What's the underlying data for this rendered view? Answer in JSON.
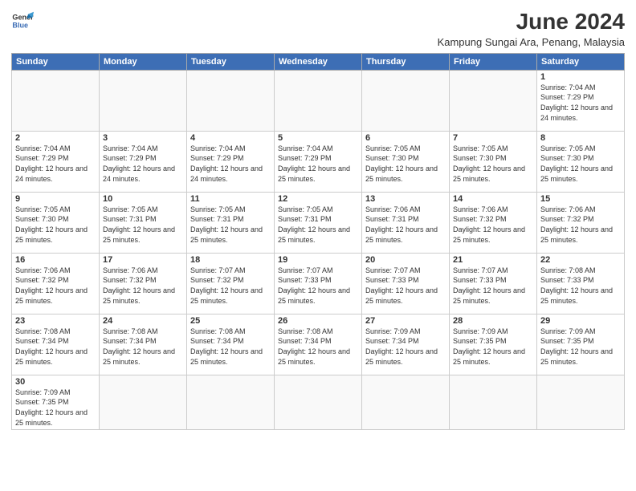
{
  "logo": {
    "line1": "General",
    "line2": "Blue"
  },
  "title": "June 2024",
  "location": "Kampung Sungai Ara, Penang, Malaysia",
  "days_of_week": [
    "Sunday",
    "Monday",
    "Tuesday",
    "Wednesday",
    "Thursday",
    "Friday",
    "Saturday"
  ],
  "weeks": [
    [
      {
        "day": "",
        "info": ""
      },
      {
        "day": "",
        "info": ""
      },
      {
        "day": "",
        "info": ""
      },
      {
        "day": "",
        "info": ""
      },
      {
        "day": "",
        "info": ""
      },
      {
        "day": "",
        "info": ""
      },
      {
        "day": "1",
        "info": "Sunrise: 7:04 AM\nSunset: 7:29 PM\nDaylight: 12 hours\nand 24 minutes."
      }
    ],
    [
      {
        "day": "2",
        "info": "Sunrise: 7:04 AM\nSunset: 7:29 PM\nDaylight: 12 hours\nand 24 minutes."
      },
      {
        "day": "3",
        "info": "Sunrise: 7:04 AM\nSunset: 7:29 PM\nDaylight: 12 hours\nand 24 minutes."
      },
      {
        "day": "4",
        "info": "Sunrise: 7:04 AM\nSunset: 7:29 PM\nDaylight: 12 hours\nand 24 minutes."
      },
      {
        "day": "5",
        "info": "Sunrise: 7:04 AM\nSunset: 7:29 PM\nDaylight: 12 hours\nand 25 minutes."
      },
      {
        "day": "6",
        "info": "Sunrise: 7:05 AM\nSunset: 7:30 PM\nDaylight: 12 hours\nand 25 minutes."
      },
      {
        "day": "7",
        "info": "Sunrise: 7:05 AM\nSunset: 7:30 PM\nDaylight: 12 hours\nand 25 minutes."
      },
      {
        "day": "8",
        "info": "Sunrise: 7:05 AM\nSunset: 7:30 PM\nDaylight: 12 hours\nand 25 minutes."
      }
    ],
    [
      {
        "day": "9",
        "info": "Sunrise: 7:05 AM\nSunset: 7:30 PM\nDaylight: 12 hours\nand 25 minutes."
      },
      {
        "day": "10",
        "info": "Sunrise: 7:05 AM\nSunset: 7:31 PM\nDaylight: 12 hours\nand 25 minutes."
      },
      {
        "day": "11",
        "info": "Sunrise: 7:05 AM\nSunset: 7:31 PM\nDaylight: 12 hours\nand 25 minutes."
      },
      {
        "day": "12",
        "info": "Sunrise: 7:05 AM\nSunset: 7:31 PM\nDaylight: 12 hours\nand 25 minutes."
      },
      {
        "day": "13",
        "info": "Sunrise: 7:06 AM\nSunset: 7:31 PM\nDaylight: 12 hours\nand 25 minutes."
      },
      {
        "day": "14",
        "info": "Sunrise: 7:06 AM\nSunset: 7:32 PM\nDaylight: 12 hours\nand 25 minutes."
      },
      {
        "day": "15",
        "info": "Sunrise: 7:06 AM\nSunset: 7:32 PM\nDaylight: 12 hours\nand 25 minutes."
      }
    ],
    [
      {
        "day": "16",
        "info": "Sunrise: 7:06 AM\nSunset: 7:32 PM\nDaylight: 12 hours\nand 25 minutes."
      },
      {
        "day": "17",
        "info": "Sunrise: 7:06 AM\nSunset: 7:32 PM\nDaylight: 12 hours\nand 25 minutes."
      },
      {
        "day": "18",
        "info": "Sunrise: 7:07 AM\nSunset: 7:32 PM\nDaylight: 12 hours\nand 25 minutes."
      },
      {
        "day": "19",
        "info": "Sunrise: 7:07 AM\nSunset: 7:33 PM\nDaylight: 12 hours\nand 25 minutes."
      },
      {
        "day": "20",
        "info": "Sunrise: 7:07 AM\nSunset: 7:33 PM\nDaylight: 12 hours\nand 25 minutes."
      },
      {
        "day": "21",
        "info": "Sunrise: 7:07 AM\nSunset: 7:33 PM\nDaylight: 12 hours\nand 25 minutes."
      },
      {
        "day": "22",
        "info": "Sunrise: 7:08 AM\nSunset: 7:33 PM\nDaylight: 12 hours\nand 25 minutes."
      }
    ],
    [
      {
        "day": "23",
        "info": "Sunrise: 7:08 AM\nSunset: 7:34 PM\nDaylight: 12 hours\nand 25 minutes."
      },
      {
        "day": "24",
        "info": "Sunrise: 7:08 AM\nSunset: 7:34 PM\nDaylight: 12 hours\nand 25 minutes."
      },
      {
        "day": "25",
        "info": "Sunrise: 7:08 AM\nSunset: 7:34 PM\nDaylight: 12 hours\nand 25 minutes."
      },
      {
        "day": "26",
        "info": "Sunrise: 7:08 AM\nSunset: 7:34 PM\nDaylight: 12 hours\nand 25 minutes."
      },
      {
        "day": "27",
        "info": "Sunrise: 7:09 AM\nSunset: 7:34 PM\nDaylight: 12 hours\nand 25 minutes."
      },
      {
        "day": "28",
        "info": "Sunrise: 7:09 AM\nSunset: 7:35 PM\nDaylight: 12 hours\nand 25 minutes."
      },
      {
        "day": "29",
        "info": "Sunrise: 7:09 AM\nSunset: 7:35 PM\nDaylight: 12 hours\nand 25 minutes."
      }
    ],
    [
      {
        "day": "30",
        "info": "Sunrise: 7:09 AM\nSunset: 7:35 PM\nDaylight: 12 hours\nand 25 minutes."
      },
      {
        "day": "",
        "info": ""
      },
      {
        "day": "",
        "info": ""
      },
      {
        "day": "",
        "info": ""
      },
      {
        "day": "",
        "info": ""
      },
      {
        "day": "",
        "info": ""
      },
      {
        "day": "",
        "info": ""
      }
    ]
  ]
}
